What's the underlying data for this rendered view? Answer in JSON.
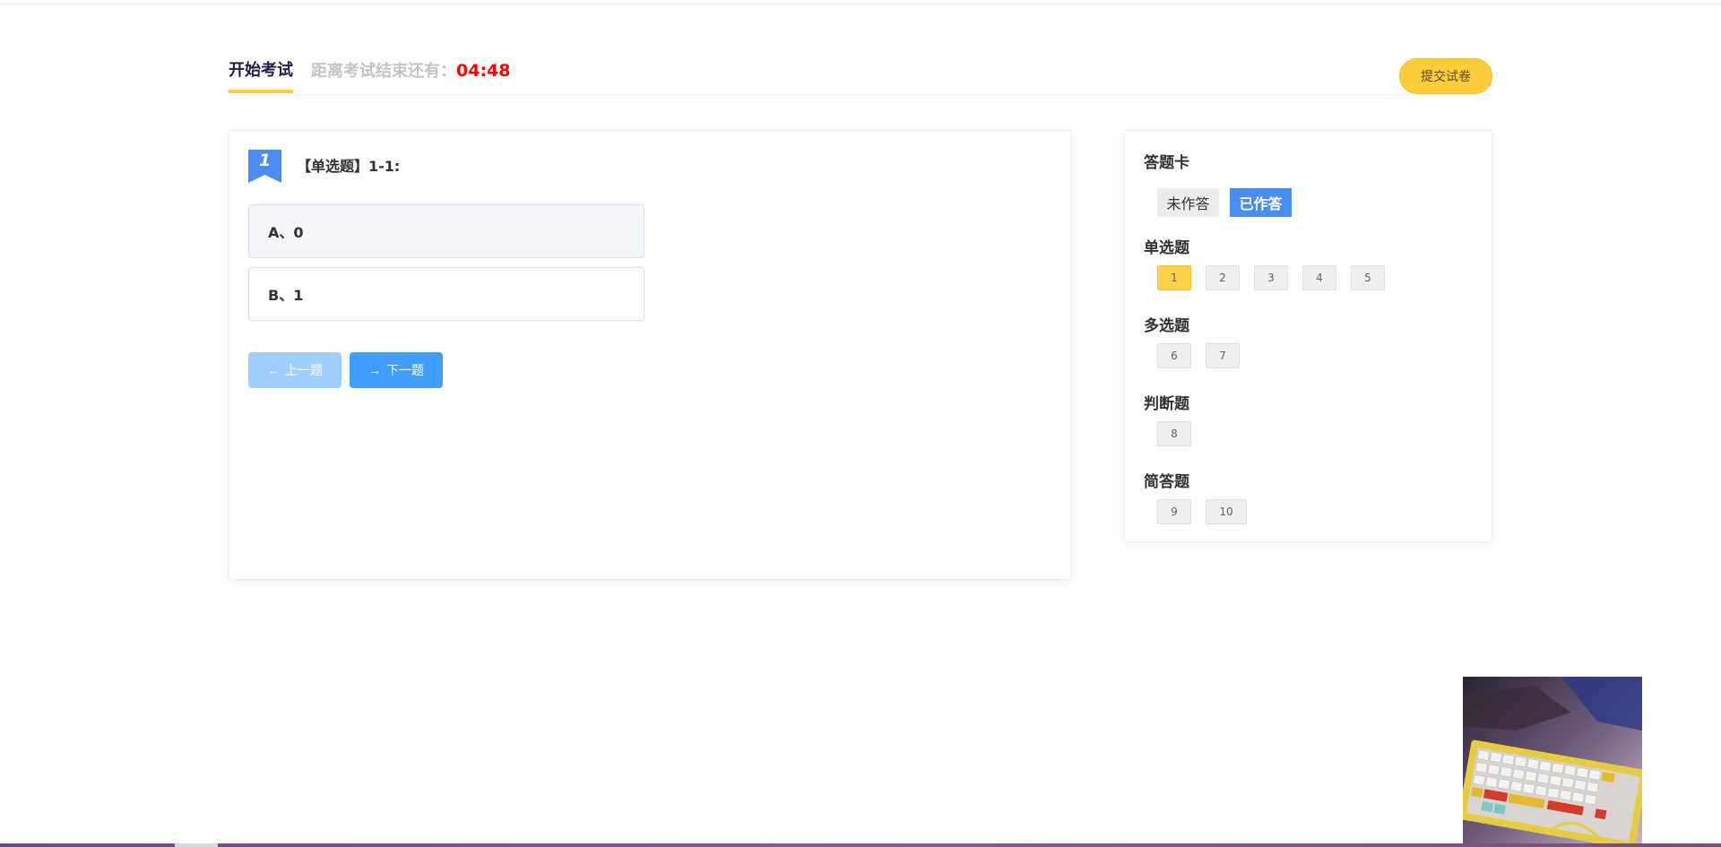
{
  "header": {
    "tab_label": "开始考试",
    "countdown_prefix": "距离考试结束还有：",
    "countdown_time": "04:48",
    "submit_label": "提交试卷"
  },
  "question": {
    "number": "1",
    "title": "【单选题】1-1:",
    "options": [
      {
        "label": "A、0",
        "selected": true
      },
      {
        "label": "B、1",
        "selected": false
      }
    ],
    "prev_label": "上一题",
    "next_label": "下一题"
  },
  "answer_card": {
    "title": "答题卡",
    "legend_unanswered": "未作答",
    "legend_answered": "已作答",
    "sections": [
      {
        "title": "单选题",
        "numbers": [
          "1",
          "2",
          "3",
          "4",
          "5"
        ],
        "current": "1"
      },
      {
        "title": "多选题",
        "numbers": [
          "6",
          "7"
        ]
      },
      {
        "title": "判断题",
        "numbers": [
          "8"
        ]
      },
      {
        "title": "简答题",
        "numbers": [
          "9",
          "10"
        ]
      }
    ]
  },
  "colors": {
    "accent_yellow": "#ffcd3c",
    "primary_blue": "#409eff",
    "answered_blue": "#4a8cf0",
    "countdown_red": "#ff0000"
  }
}
